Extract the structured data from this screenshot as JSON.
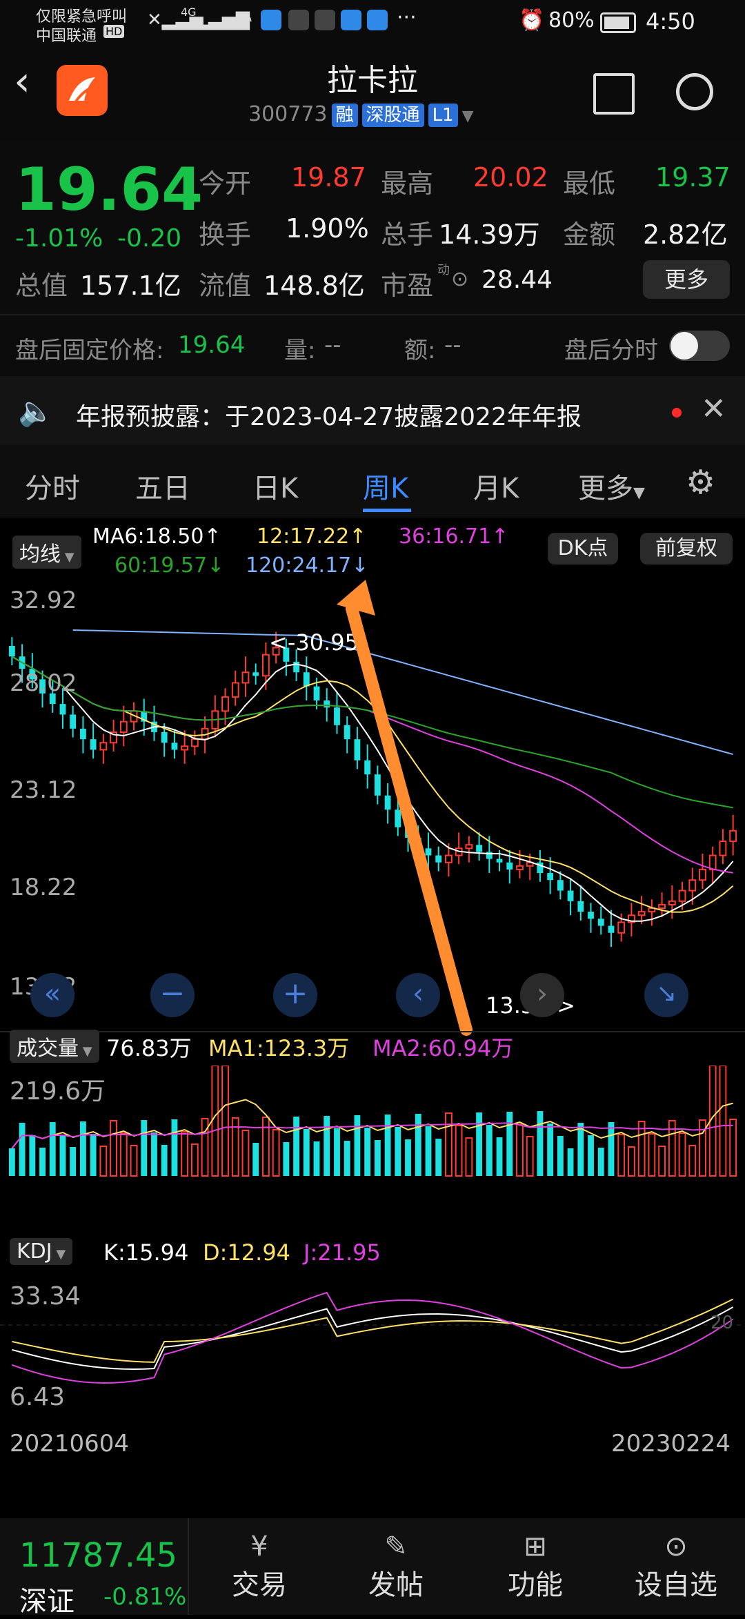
{
  "status": {
    "left_line1": "仅限紧急呼叫",
    "left_line2": "中国联通",
    "hd": "HD",
    "net": "4G",
    "battery": "80%",
    "time": "4:50"
  },
  "header": {
    "title": "拉卡拉",
    "code": "300773",
    "tags": [
      "融",
      "深股通",
      "L1"
    ]
  },
  "quote": {
    "price": "19.64",
    "pct": "-1.01%",
    "chg": "-0.20",
    "open_label": "今开",
    "open": "19.87",
    "high_label": "最高",
    "high": "20.02",
    "low_label": "最低",
    "low": "19.37",
    "turnover_label": "换手",
    "turnover": "1.90%",
    "volume_label": "总手",
    "volume": "14.39万",
    "amount_label": "金额",
    "amount": "2.82亿",
    "mktcap_label": "总值",
    "mktcap": "157.1亿",
    "float_label": "流值",
    "float": "148.8亿",
    "pe_label": "市盈",
    "pe_sup": "动",
    "pe": "28.44",
    "more": "更多",
    "after_label": "盘后固定价格:",
    "after_price": "19.64",
    "after_vol_label": "量:",
    "after_vol": "--",
    "after_amt_label": "额:",
    "after_amt": "--",
    "after_tick": "盘后分时"
  },
  "notice": {
    "text": "年报预披露：于2023-04-27披露2022年年报"
  },
  "tabs": [
    "分时",
    "五日",
    "日K",
    "周K",
    "月K",
    "更多"
  ],
  "chart": {
    "ma_selector": "均线",
    "ma6": "MA6:18.50↑",
    "ma12": "12:17.22↑",
    "ma36": "36:16.71↑",
    "ma60": "60:19.57↓",
    "ma120": "120:24.17↓",
    "dk_button": "DK点",
    "fq_button": "前复权",
    "y_labels": [
      "32.92",
      "28.02",
      "23.12",
      "18.22",
      "13.32"
    ],
    "high_marker": "<-30.95",
    "low_marker": "13.32->",
    "volume_selector": "成交量",
    "vol_value": "76.83万",
    "vol_ma1": "MA1:123.3万",
    "vol_ma2": "MA2:60.94万",
    "vol_max": "219.6万",
    "kdj_selector": "KDJ",
    "kdj_k": "K:15.94",
    "kdj_d": "D:12.94",
    "kdj_j": "J:21.95",
    "kdj_top": "33.34",
    "kdj_bottom": "6.43",
    "kdj_ref": "20",
    "date_start": "20210604",
    "date_end": "20230224"
  },
  "bottom": {
    "index_value": "11787.45",
    "index_name": "深证",
    "index_pct": "-0.81%",
    "nav": [
      "交易",
      "发帖",
      "功能",
      "设自选"
    ]
  },
  "colors": {
    "up": "#ff3b30",
    "down": "#19c34a",
    "accent": "#3d8bff",
    "candle_down": "#1de0e0",
    "ma6": "#ffffff",
    "ma12": "#ffe066",
    "ma36": "#e040e0",
    "ma60": "#2aa52a",
    "ma120": "#7fb3ff",
    "arrow": "#ff8c2e"
  },
  "chart_data": {
    "type": "line",
    "x_range": [
      "20210604",
      "20230224"
    ],
    "ylim": [
      13.32,
      32.92
    ],
    "y_ticks": [
      32.92,
      28.02,
      23.12,
      18.22,
      13.32
    ],
    "series": [
      {
        "name": "MA6",
        "last": 18.5
      },
      {
        "name": "12",
        "last": 17.22
      },
      {
        "name": "36",
        "last": 16.71
      },
      {
        "name": "60",
        "last": 19.57
      },
      {
        "name": "120",
        "last": 24.17
      }
    ],
    "close_approx": [
      29.5,
      28.8,
      28.2,
      27.4,
      26.8,
      26.2,
      25.4,
      24.8,
      24.2,
      24.6,
      25.2,
      25.8,
      26.4,
      25.8,
      25.2,
      24.6,
      24.2,
      24.4,
      24.8,
      25.4,
      26.4,
      27.2,
      28.0,
      28.6,
      28.4,
      29.6,
      30.0,
      29.2,
      28.6,
      27.8,
      27.0,
      26.6,
      25.6,
      24.8,
      23.6,
      22.8,
      21.6,
      20.8,
      19.8,
      19.2,
      18.6,
      18.2,
      17.8,
      18.2,
      18.6,
      18.8,
      18.4,
      18.0,
      17.8,
      17.4,
      17.6,
      17.8,
      17.2,
      16.8,
      16.2,
      15.6,
      15.0,
      14.6,
      14.2,
      13.8,
      14.4,
      14.8,
      15.0,
      15.2,
      15.4,
      15.6,
      16.2,
      16.8,
      17.4,
      18.2,
      19.0,
      19.6
    ]
  }
}
